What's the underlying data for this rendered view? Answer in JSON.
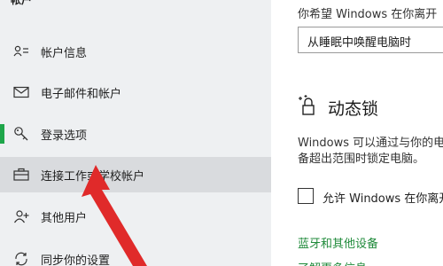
{
  "sidebar": {
    "title": "帐户",
    "items": [
      {
        "label": "帐户信息"
      },
      {
        "label": "电子邮件和帐户"
      },
      {
        "label": "登录选项"
      },
      {
        "label": "连接工作或学校帐户"
      },
      {
        "label": "其他用户"
      },
      {
        "label": "同步你的设置"
      }
    ],
    "selected_index": 2,
    "hovered_index": 3
  },
  "main": {
    "hint_text": "你希望 Windows 在你离开",
    "dropdown": {
      "value": "从睡眠中唤醒电脑时"
    },
    "dynamic_lock": {
      "title": "动态锁",
      "desc_line1": "Windows 可以通过与你的电",
      "desc_line2": "备超出范围时锁定电脑。",
      "checkbox_label": "允许 Windows 在你离开",
      "checkbox_checked": false
    },
    "links": [
      "蓝牙和其他设备",
      "了解更多信息"
    ]
  },
  "colors": {
    "accent": "#1ea64a",
    "link": "#1f8a3a",
    "arrow": "#e02a2a",
    "sidebar_bg": "#eef0f2"
  }
}
